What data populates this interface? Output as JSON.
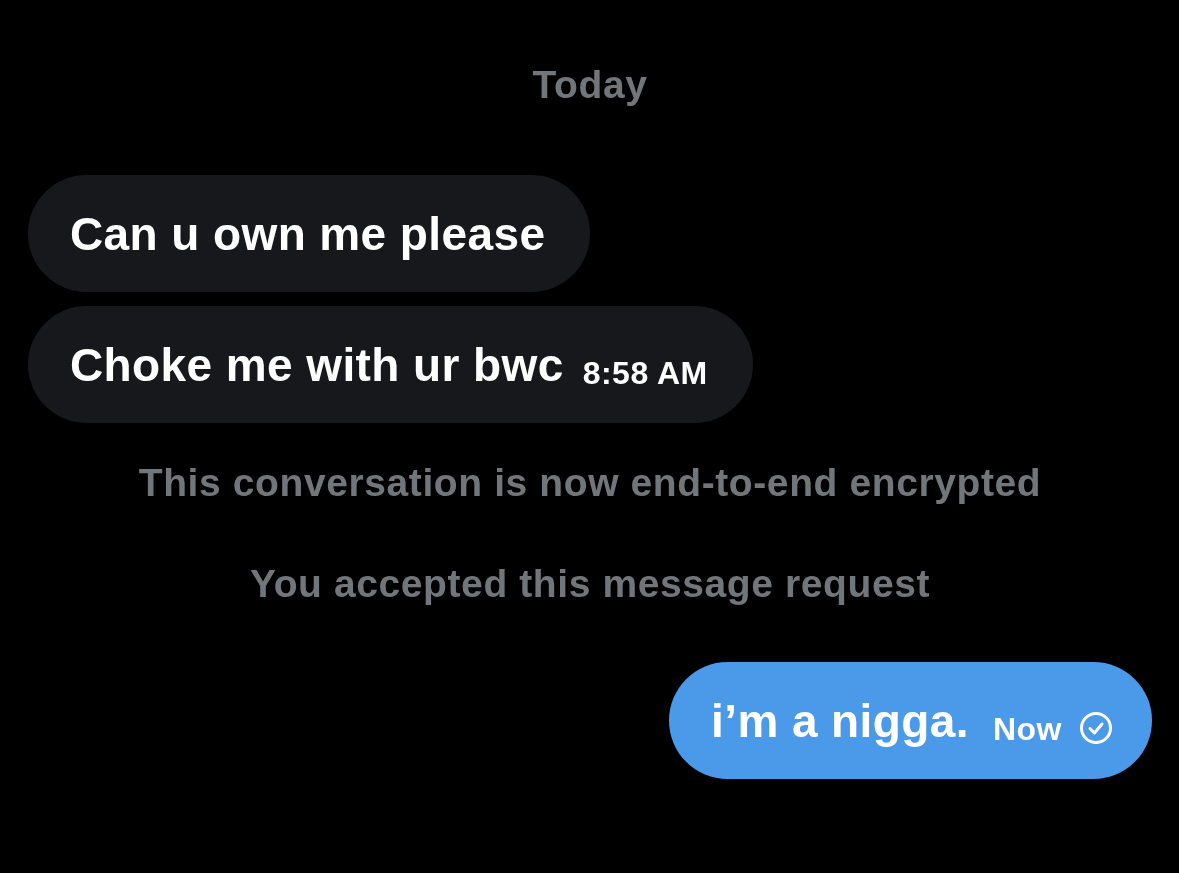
{
  "messages": [
    {
      "kind": "date",
      "text": "Today"
    },
    {
      "kind": "incoming",
      "text": "Can u own me please"
    },
    {
      "kind": "incoming",
      "text": "Choke me with ur bwc",
      "time": "8:58 AM"
    },
    {
      "kind": "system",
      "text": "This conversation is now end-to-end encrypted"
    },
    {
      "kind": "system",
      "text": "You accepted this message request"
    },
    {
      "kind": "outgoing",
      "text": "i’m a nigga.",
      "time": "Now",
      "sent": true
    }
  ]
}
